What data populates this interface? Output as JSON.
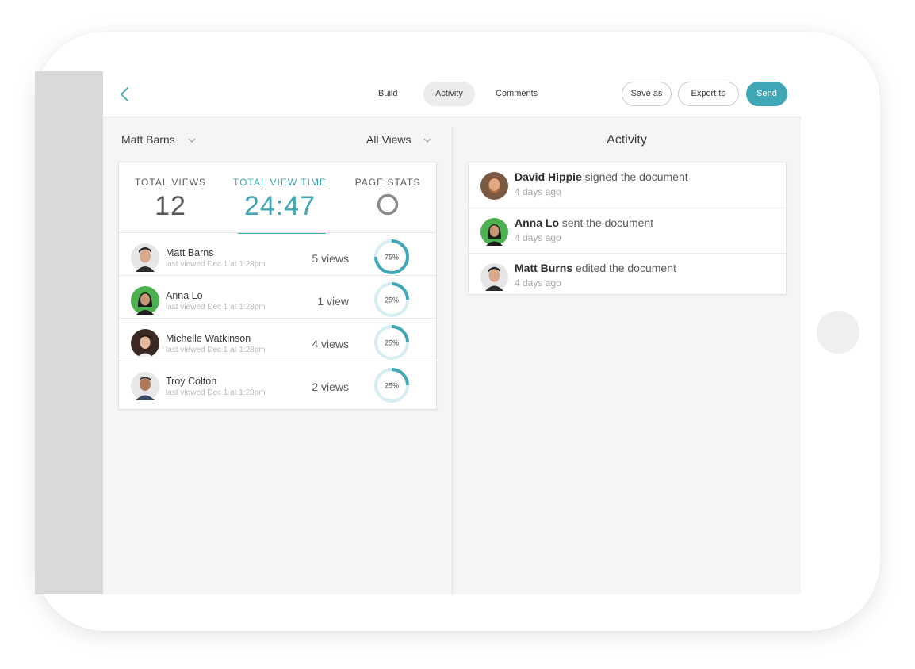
{
  "toolbar": {
    "tabs": [
      {
        "label": "Build"
      },
      {
        "label": "Activity",
        "active": true
      },
      {
        "label": "Comments"
      }
    ],
    "save_label": "Save as",
    "export_label": "Export to",
    "send_label": "Send"
  },
  "filters": {
    "user": "Matt Barns",
    "views": "All Views"
  },
  "stats": {
    "total_views_label": "TOTAL VIEWS",
    "total_views": "12",
    "total_view_time_label": "TOTAL VIEW TIME",
    "total_view_time": "24:47",
    "page_stats_label": "PAGE STATS"
  },
  "viewers": [
    {
      "name": "Matt Barns",
      "last_viewed": "last viewed Dec 1 at 1:28pm",
      "views": "5 views",
      "percent_label": "75%",
      "percent": 0.75
    },
    {
      "name": "Anna Lo",
      "last_viewed": "last viewed Dec 1 at 1:28pm",
      "views": "1 view",
      "percent_label": "25%",
      "percent": 0.25
    },
    {
      "name": "Michelle Watkinson",
      "last_viewed": "last viewed Dec 1 at 1:28pm",
      "views": "4 views",
      "percent_label": "25%",
      "percent": 0.25
    },
    {
      "name": "Troy Colton",
      "last_viewed": "last viewed Dec 1 at 1:28pm",
      "views": "2 views",
      "percent_label": "25%",
      "percent": 0.25
    }
  ],
  "activity": {
    "title": "Activity",
    "items": [
      {
        "name": "David Hippie",
        "action": " signed the document",
        "time": "4 days ago"
      },
      {
        "name": "Anna Lo",
        "action": " sent the document",
        "time": "4 days ago"
      },
      {
        "name": "Matt Burns",
        "action": " edited the document",
        "time": "4 days ago"
      }
    ]
  },
  "colors": {
    "accent": "#3fa7b6",
    "ring_track": "#d6eef1",
    "avatar_green": "#4caf50"
  }
}
